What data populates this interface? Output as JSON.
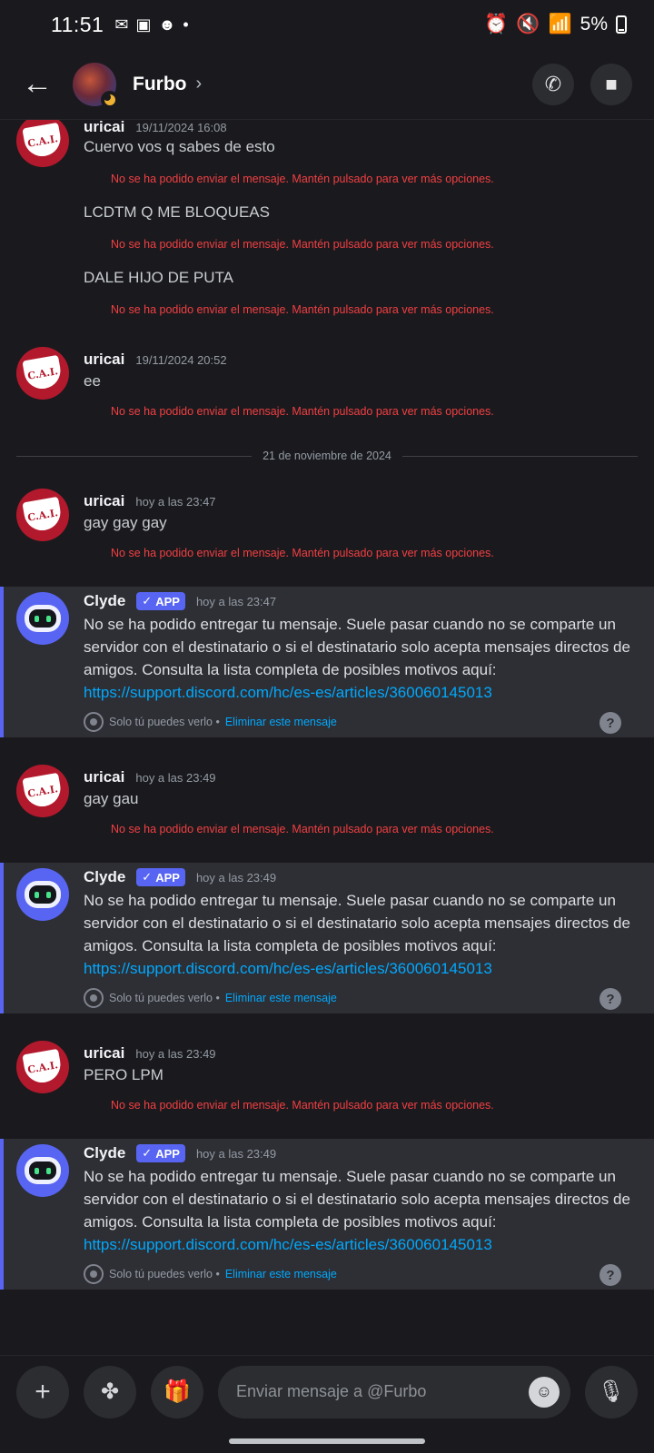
{
  "status_bar": {
    "time": "11:51",
    "battery": "5%"
  },
  "header": {
    "title": "Furbo",
    "chevron": "›",
    "back_icon": "arrow-left-icon",
    "call_icon": "phone-icon",
    "video_icon": "video-camera-icon"
  },
  "error_text": "No se ha podido enviar el mensaje. Mantén pulsado para ver más opciones.",
  "messages": [
    {
      "author": "uricai",
      "time": "19/11/2024 16:08",
      "lines": [
        "Cuervo vos q sabes de esto",
        "LCDTM Q ME BLOQUEAS",
        "DALE HIJO DE PUTA"
      ]
    },
    {
      "author": "uricai",
      "time": "19/11/2024 20:52",
      "lines": [
        "ee"
      ]
    },
    {
      "author": "uricai",
      "time": "hoy a las 23:47",
      "lines": [
        "gay gay gay"
      ]
    },
    {
      "author": "uricai",
      "time": "hoy a las 23:49",
      "lines": [
        "gay gau"
      ]
    },
    {
      "author": "uricai",
      "time": "hoy a las 23:49",
      "lines": [
        "PERO LPM"
      ]
    }
  ],
  "avatar_text": "C.A.I.",
  "date_divider": "21 de noviembre de 2024",
  "clyde": {
    "author": "Clyde",
    "badge": "APP",
    "text": "No se ha podido entregar tu mensaje. Suele pasar cuando no se comparte un servidor con el destinatario o si el destinatario solo acepta mensajes directos de amigos. Consulta la lista completa de posibles motivos aquí:",
    "link": "https://support.discord.com/hc/es-es/articles/360060145013",
    "only_you": "Solo tú puedes verlo •",
    "delete": "Eliminar este mensaje",
    "help": "?",
    "times": [
      "hoy a las 23:47",
      "hoy a las 23:49",
      "hoy a las 23:49"
    ]
  },
  "composer": {
    "placeholder": "Enviar mensaje a @Furbo"
  }
}
